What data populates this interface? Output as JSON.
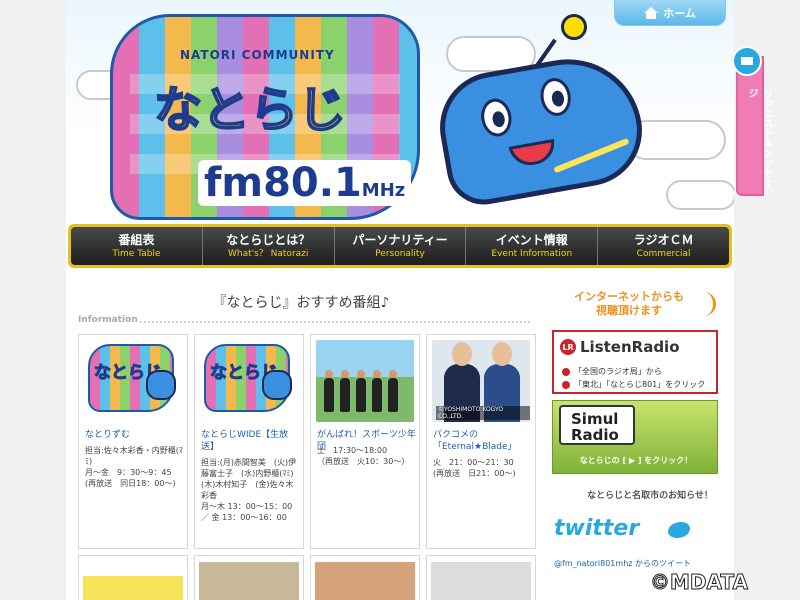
{
  "header": {
    "home_label": "ホーム",
    "logo_top": "NATORI COMMUNITY",
    "logo_name": "なとらじ",
    "logo_freq": "fm80.1",
    "logo_unit": "MHz"
  },
  "nav": [
    {
      "jp": "番組表",
      "en": "Time Table"
    },
    {
      "jp": "なとらじとは？",
      "en": "What's？ Natorazi"
    },
    {
      "jp": "パーソナリティー",
      "en": "Personality"
    },
    {
      "jp": "イベント情報",
      "en": "Event Information"
    },
    {
      "jp": "ラジオＣＭ",
      "en": "Commercial"
    }
  ],
  "main": {
    "title": "『なとらじ』おすすめ番組♪",
    "info_label": "Information",
    "cards": [
      {
        "title": "なとりずむ",
        "body": "担当:佐々木彩香・内野櫃(ﾏﾐ)\n月〜金　9：30〜9：45\n(再放送　同日18：00〜)"
      },
      {
        "title": "なとらじWIDE【生放送】",
        "body": "担当:(月)赤間智美　(火)伊藤富士子　(水)内野櫃(ﾏﾐ)　(木)木村知子　(金)佐々木彩香\n月〜木 13：00〜15：00　／ 金 13：00〜16：00"
      },
      {
        "title": "がんばれ！スポーツ少年団",
        "body": "土　17:30〜18:00\n（再放送　火10：30〜）"
      },
      {
        "title": "パクコメの「Eternal★Blade」",
        "body": "火　21：00〜21：30\n(再放送　日21：00〜)",
        "copyright": "©YOSHIMOTO KOGYO CO.,LTD."
      }
    ]
  },
  "sidebar": {
    "net_title": "インターネットからも\n視聴頂けます",
    "listen_logo": "ListenRadio",
    "listen_line1": "「全国のラジオ局」から",
    "listen_line2": "「東北」「なとらじ801」をクリック",
    "simul_logo": "Simul Radio",
    "simul_caption": "なとらじの [ ▶ ] をクリック！",
    "notice": "なとらじと名取市のお知らせ！",
    "twitter": "twitter",
    "tweet_link": "@fm_natori801mhz からのツイート"
  },
  "request_tab": "リクエスト＆メッセージ",
  "watermark": "©MDATA"
}
